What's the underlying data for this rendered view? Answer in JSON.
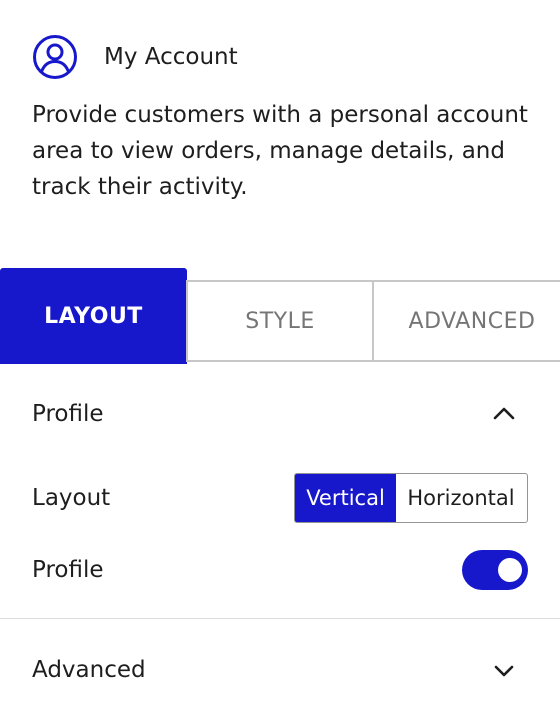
{
  "header": {
    "title": "My Account",
    "icon": "user-circle-icon",
    "icon_color": "#1717cc"
  },
  "description": "Provide customers with a personal account area to view orders, manage details, and track their activity.",
  "tabs": [
    {
      "label": "LAYOUT",
      "active": true
    },
    {
      "label": "STYLE",
      "active": false
    },
    {
      "label": "ADVANCED",
      "active": false
    }
  ],
  "panels": {
    "profile": {
      "label": "Profile",
      "expanded": true,
      "icon": "chevron-up-icon",
      "layout_row": {
        "label": "Layout",
        "options": [
          "Vertical",
          "Horizontal"
        ],
        "selected": "Vertical"
      },
      "profile_row": {
        "label": "Profile",
        "toggle_on": true
      }
    },
    "advanced": {
      "label": "Advanced",
      "expanded": false,
      "icon": "chevron-down-icon"
    }
  },
  "colors": {
    "accent": "#1717cc",
    "text": "#1e1e1e",
    "muted": "#757575",
    "border": "#c7c7c7"
  }
}
